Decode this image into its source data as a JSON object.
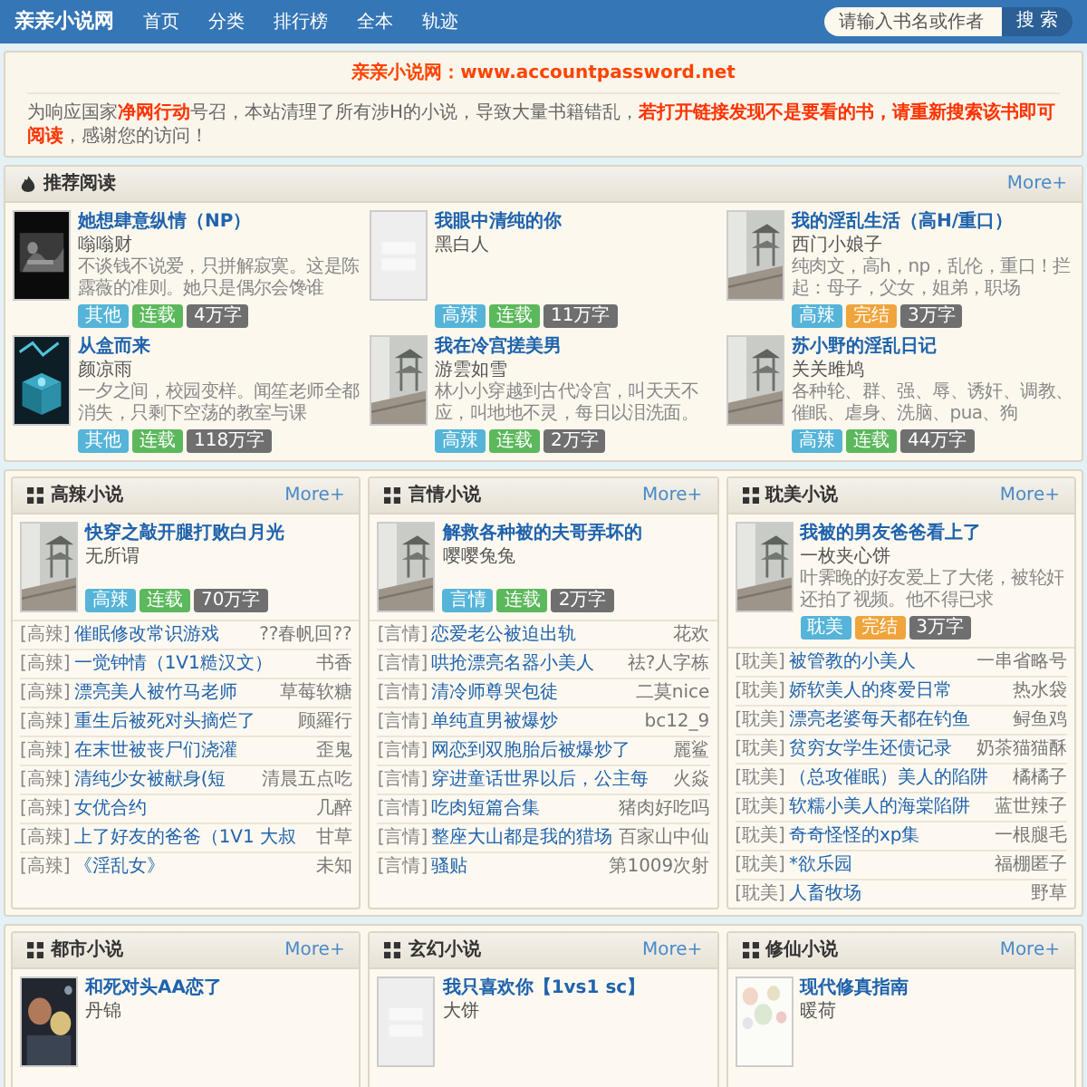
{
  "header": {
    "logo": "亲亲小说网",
    "nav": [
      {
        "label": "首页"
      },
      {
        "label": "分类"
      },
      {
        "label": "排行榜"
      },
      {
        "label": "全本"
      },
      {
        "label": "轨迹"
      }
    ],
    "search": {
      "placeholder": "请输入书名或作者",
      "button": "搜 索"
    }
  },
  "notice": {
    "title": "亲亲小说网：www.accountpassword.net",
    "text": "为响应国家**净网行动**号召，本站清理了所有涉H的小说，导致大量书籍错乱，**若打开链接发现不是要看的书，请重新搜索该书即可阅读**，感谢您的访问！"
  },
  "recommended": {
    "title": "推荐阅读",
    "more": "More+",
    "books": [
      {
        "title": "她想肆意纵情（NP）",
        "author": "嗡嗡财",
        "description": "不谈钱不说爱，只拼解寂寞。这是陈露薇的准则。她只是偶尔会馋谁",
        "genre": "其他",
        "status": "连载",
        "finished": false,
        "words": "4万字"
      },
      {
        "title": "我眼中清纯的你",
        "author": "黑白人",
        "genre": "高辣",
        "status": "连载",
        "finished": false,
        "words": "11万字"
      },
      {
        "title": "我的淫乱生活（高H/重口）",
        "author": "西门小娘子",
        "description": "纯肉文，高h，np，乱伦，重口！拦起：母子，父女，姐弟，职场",
        "genre": "高辣",
        "status": "完结",
        "finished": true,
        "words": "3万字"
      },
      {
        "title": "从盒而来",
        "author": "颜凉雨",
        "description": "一夕之间，校园变样。闻笙老师全都消失，只剩下空荡的教室与课",
        "genre": "其他",
        "status": "连载",
        "finished": false,
        "words": "118万字"
      },
      {
        "title": "我在冷宫搓美男",
        "author": "游雲如雪",
        "description": "林小小穿越到古代冷宫，叫天天不应，叫地地不灵，每日以泪洗面。",
        "genre": "高辣",
        "status": "连载",
        "finished": false,
        "words": "2万字"
      },
      {
        "title": "苏小野的淫乱日记",
        "author": "关关雎鸠",
        "description": "各种轮、群、强、辱、诱奸、调教、催眠、虐身、洗脑、pua、狗",
        "genre": "高辣",
        "status": "连载",
        "finished": false,
        "words": "44万字"
      }
    ]
  },
  "categories": [
    {
      "title": "高辣小说",
      "more": "More+",
      "featured": {
        "title": "快穿之敲开腿打败白月光",
        "author": "无所谓",
        "genre": "高辣",
        "status": "连载",
        "finished": false,
        "words": "70万字"
      },
      "list": [
        {
          "tag": "[高辣]",
          "title": "催眠修改常识游戏",
          "author": "??春帆回??"
        },
        {
          "tag": "[高辣]",
          "title": "一觉钟情（1V1糙汉文）",
          "author": "书香"
        },
        {
          "tag": "[高辣]",
          "title": "漂亮美人被竹马老师",
          "author": "草莓软糖"
        },
        {
          "tag": "[高辣]",
          "title": "重生后被死对头摘烂了",
          "author": "顾羅行"
        },
        {
          "tag": "[高辣]",
          "title": "在末世被丧尸们浇灌",
          "author": "歪鬼"
        },
        {
          "tag": "[高辣]",
          "title": "清纯少女被献身(短",
          "author": "清晨五点吃"
        },
        {
          "tag": "[高辣]",
          "title": "女优合约",
          "author": "几醉"
        },
        {
          "tag": "[高辣]",
          "title": "上了好友的爸爸（1V1 大叔",
          "author": "甘草"
        },
        {
          "tag": "[高辣]",
          "title": "《淫乱女》",
          "author": "未知"
        }
      ]
    },
    {
      "title": "言情小说",
      "more": "More+",
      "featured": {
        "title": "解救各种被的夫哥弄坏的",
        "author": "嘤嘤兔兔",
        "genre": "言情",
        "status": "连载",
        "finished": false,
        "words": "2万字"
      },
      "list": [
        {
          "tag": "[言情]",
          "title": "恋爱老公被迫出轨",
          "author": "花欢"
        },
        {
          "tag": "[言情]",
          "title": "哄抢漂亮名器小美人",
          "author": "祛?人字栋"
        },
        {
          "tag": "[言情]",
          "title": "清冷师尊哭包徒",
          "author": "二莫nice"
        },
        {
          "tag": "[言情]",
          "title": "单纯直男被爆炒",
          "author": "bc12_9"
        },
        {
          "tag": "[言情]",
          "title": "网恋到双胞胎后被爆炒了",
          "author": "麗鲨"
        },
        {
          "tag": "[言情]",
          "title": "穿进童话世界以后，公主每",
          "author": "火焱"
        },
        {
          "tag": "[言情]",
          "title": "吃肉短篇合集",
          "author": "猪肉好吃吗"
        },
        {
          "tag": "[言情]",
          "title": "整座大山都是我的猎场",
          "author": "百家山中仙"
        },
        {
          "tag": "[言情]",
          "title": "骚贴",
          "author": "第1009次射"
        }
      ]
    },
    {
      "title": "耽美小说",
      "more": "More+",
      "featured": {
        "title": "我被的男友爸爸看上了",
        "author": "一枚夹心饼",
        "description": "叶霁晚的好友爱上了大佬，被轮奸还拍了视频。他不得已求",
        "genre": "耽美",
        "status": "完结",
        "finished": true,
        "words": "3万字"
      },
      "list": [
        {
          "tag": "[耽美]",
          "title": "被管教的小美人",
          "author": "一串省略号"
        },
        {
          "tag": "[耽美]",
          "title": "娇软美人的疼爱日常",
          "author": "热水袋"
        },
        {
          "tag": "[耽美]",
          "title": "漂亮老婆每天都在钓鱼",
          "author": "鲟鱼鸡"
        },
        {
          "tag": "[耽美]",
          "title": "贫穷女学生还债记录",
          "author": "奶茶猫猫酥"
        },
        {
          "tag": "[耽美]",
          "title": "（总攻催眠）美人的陷阱",
          "author": "橘橘子"
        },
        {
          "tag": "[耽美]",
          "title": "软糯小美人的海棠陷阱",
          "author": "蓝世辣子"
        },
        {
          "tag": "[耽美]",
          "title": "奇奇怪怪的xp集",
          "author": "一根腿毛"
        },
        {
          "tag": "[耽美]",
          "title": "*欲乐园",
          "author": "福棚匿子"
        },
        {
          "tag": "[耽美]",
          "title": "人畜牧场",
          "author": "野草"
        }
      ]
    }
  ],
  "bottom_categories": [
    {
      "title": "都市小说",
      "more": "More+",
      "featured": {
        "title": "和死对头AA恋了",
        "author": "丹锦"
      }
    },
    {
      "title": "玄幻小说",
      "more": "More+",
      "featured": {
        "title": "我只喜欢你【1vs1 sc】",
        "author": "大饼"
      }
    },
    {
      "title": "修仙小说",
      "more": "More+",
      "featured": {
        "title": "现代修真指南",
        "author": "暖荷"
      }
    }
  ]
}
